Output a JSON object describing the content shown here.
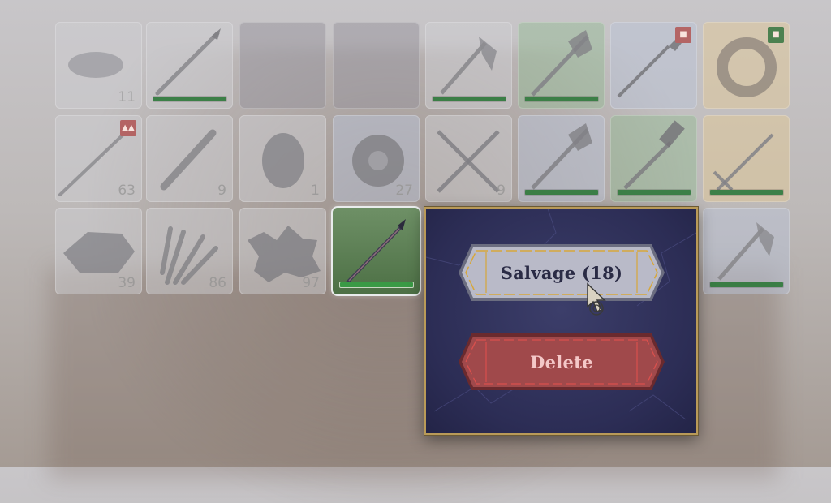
{
  "inventory": {
    "rows": [
      [
        {
          "item": "round-stone-icon",
          "count": "11",
          "durability": null,
          "badge": null,
          "tint": "default"
        },
        {
          "item": "spear-icon",
          "count": "",
          "durability": 1.0,
          "badge": null,
          "tint": "default"
        },
        {
          "item": "empty-slot",
          "count": "",
          "durability": null,
          "badge": null,
          "tint": "dark"
        },
        {
          "item": "empty-slot",
          "count": "",
          "durability": null,
          "badge": null,
          "tint": "dark"
        },
        {
          "item": "axe-icon",
          "count": "",
          "durability": 1.0,
          "badge": null,
          "tint": "default"
        },
        {
          "item": "halberd-icon",
          "count": "",
          "durability": 1.0,
          "badge": null,
          "tint": "green"
        },
        {
          "item": "staff-icon",
          "count": "",
          "durability": null,
          "badge": "red",
          "tint": "blue"
        },
        {
          "item": "ring-icon",
          "count": "",
          "durability": null,
          "badge": "green",
          "tint": "orange"
        }
      ],
      [
        {
          "item": "long-spear-icon",
          "count": "63",
          "durability": null,
          "badge": "red-up",
          "tint": "default"
        },
        {
          "item": "stick-icon",
          "count": "9",
          "durability": null,
          "badge": null,
          "tint": "default"
        },
        {
          "item": "egg-stone-icon",
          "count": "1",
          "durability": null,
          "badge": null,
          "tint": "default"
        },
        {
          "item": "disc-icon",
          "count": "27",
          "durability": null,
          "badge": null,
          "tint": "blue"
        },
        {
          "item": "crossed-swords-icon",
          "count": "9",
          "durability": null,
          "badge": null,
          "tint": "default"
        },
        {
          "item": "halberd-icon",
          "count": "",
          "durability": 1.0,
          "badge": null,
          "tint": "blue"
        },
        {
          "item": "mace-icon",
          "count": "",
          "durability": 1.0,
          "badge": null,
          "tint": "green"
        },
        {
          "item": "sword-icon",
          "count": "",
          "durability": 1.0,
          "badge": null,
          "tint": "orange"
        }
      ],
      [
        {
          "item": "flat-stone-icon",
          "count": "39",
          "durability": null,
          "badge": null,
          "tint": "default"
        },
        {
          "item": "sticks-bundle-icon",
          "count": "86",
          "durability": null,
          "badge": null,
          "tint": "default"
        },
        {
          "item": "debris-icon",
          "count": "97",
          "durability": null,
          "badge": null,
          "tint": "default"
        },
        {
          "item": "spear-icon",
          "count": "",
          "durability": 1.0,
          "badge": null,
          "tint": "selected"
        },
        {
          "item": "hidden",
          "count": "",
          "durability": null,
          "badge": null,
          "tint": "hidden"
        },
        {
          "item": "hidden",
          "count": "",
          "durability": null,
          "badge": null,
          "tint": "hidden"
        },
        {
          "item": "hidden",
          "count": "",
          "durability": null,
          "badge": null,
          "tint": "hidden"
        },
        {
          "item": "axe-icon",
          "count": "",
          "durability": 1.0,
          "badge": null,
          "tint": "blue"
        }
      ]
    ]
  },
  "context_menu": {
    "salvage_label": "Salvage (18)",
    "delete_label": "Delete"
  },
  "colors": {
    "durability_green": "#2f7a3c",
    "popup_bg": "#2c2d55",
    "popup_border": "#b99a58",
    "salvage_button": "#b9bac8",
    "delete_button": "#a0494b"
  }
}
